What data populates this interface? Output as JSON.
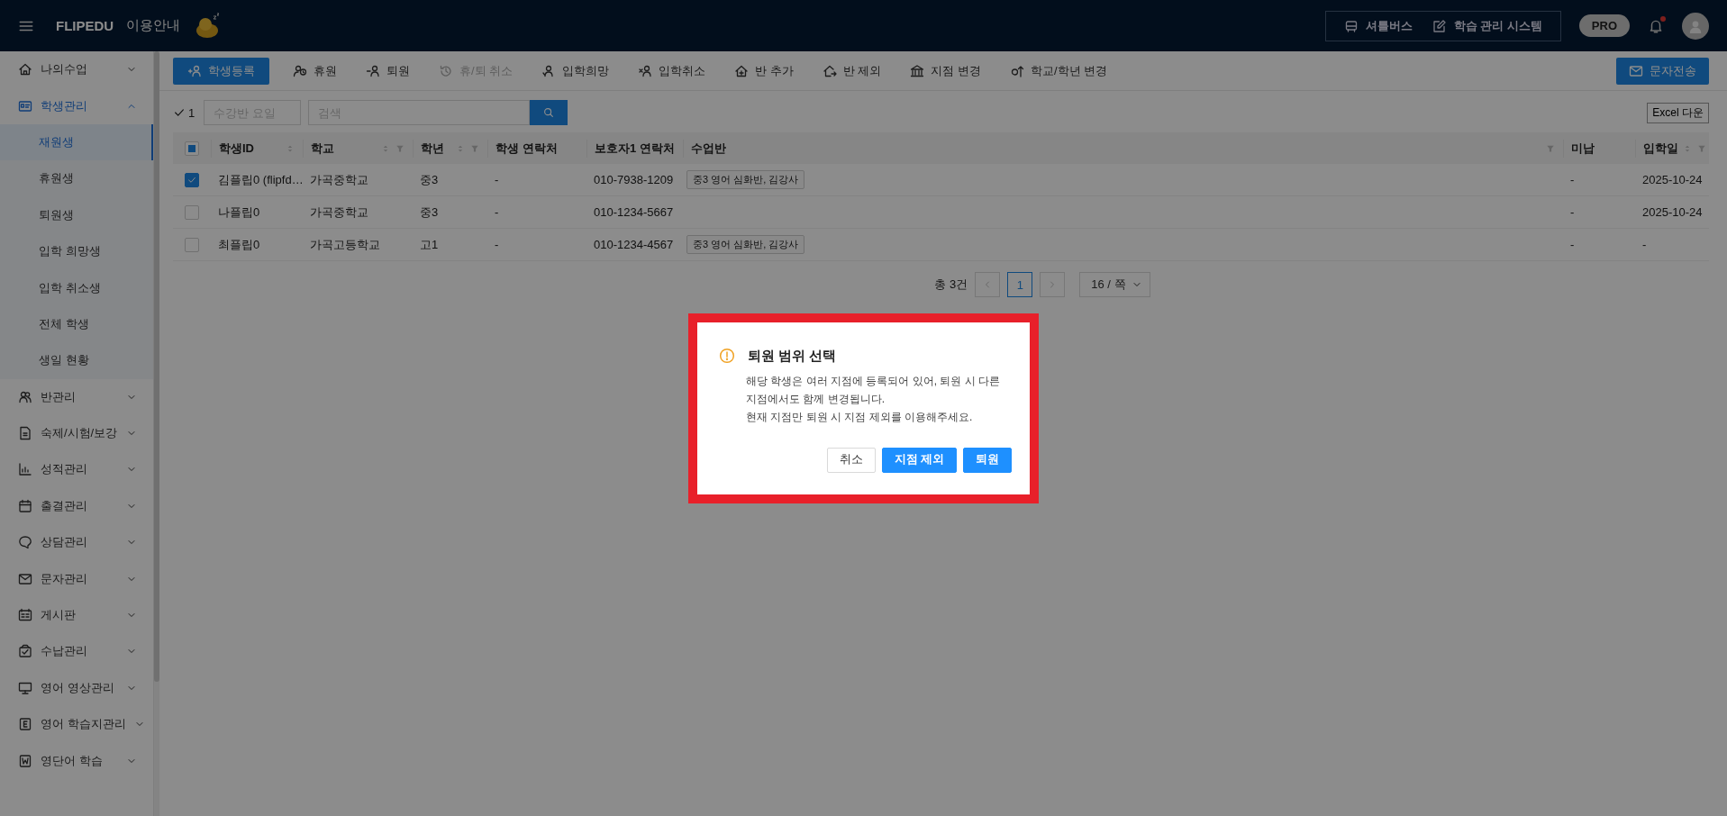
{
  "header": {
    "brand": "FLIPEDU",
    "guide_link": "이용안내",
    "links": [
      {
        "label": "셔틀버스"
      },
      {
        "label": "학습 관리 시스템"
      }
    ],
    "plan_badge": "PRO",
    "has_notification": true
  },
  "sidebar": {
    "items": [
      {
        "label": "나의수업",
        "selected": false,
        "expanded": false
      },
      {
        "label": "학생관리",
        "selected": true,
        "expanded": true,
        "children": [
          {
            "label": "재원생",
            "selected": true
          },
          {
            "label": "휴원생",
            "selected": false
          },
          {
            "label": "퇴원생",
            "selected": false
          },
          {
            "label": "입학 희망생",
            "selected": false
          },
          {
            "label": "입학 취소생",
            "selected": false
          },
          {
            "label": "전체 학생",
            "selected": false
          },
          {
            "label": "생일 현황",
            "selected": false
          }
        ]
      },
      {
        "label": "반관리",
        "selected": false,
        "expanded": false
      },
      {
        "label": "숙제/시험/보강",
        "selected": false,
        "expanded": false
      },
      {
        "label": "성적관리",
        "selected": false,
        "expanded": false
      },
      {
        "label": "출결관리",
        "selected": false,
        "expanded": false
      },
      {
        "label": "상담관리",
        "selected": false,
        "expanded": false
      },
      {
        "label": "문자관리",
        "selected": false,
        "expanded": false
      },
      {
        "label": "게시판",
        "selected": false,
        "expanded": false
      },
      {
        "label": "수납관리",
        "selected": false,
        "expanded": false
      },
      {
        "label": "영어 영상관리",
        "selected": false,
        "expanded": false
      },
      {
        "label": "영어 학습지관리",
        "selected": false,
        "expanded": false
      },
      {
        "label": "영단어 학습",
        "selected": false,
        "expanded": false
      }
    ]
  },
  "toolbar": {
    "actions": [
      {
        "label": "학생등록",
        "kind": "primary",
        "disabled": false
      },
      {
        "label": "휴원",
        "kind": "plain",
        "disabled": false
      },
      {
        "label": "퇴원",
        "kind": "plain",
        "disabled": false
      },
      {
        "label": "휴/퇴 취소",
        "kind": "plain",
        "disabled": true
      },
      {
        "label": "입학희망",
        "kind": "plain",
        "disabled": false
      },
      {
        "label": "입학취소",
        "kind": "plain",
        "disabled": false
      },
      {
        "label": "반 추가",
        "kind": "plain",
        "disabled": false
      },
      {
        "label": "반 제외",
        "kind": "plain",
        "disabled": false
      },
      {
        "label": "지점 변경",
        "kind": "plain",
        "disabled": false
      },
      {
        "label": "학교/학년 변경",
        "kind": "plain",
        "disabled": false
      }
    ],
    "send_button": "문자전송"
  },
  "filters": {
    "selected_count": "1",
    "day_field": {
      "placeholder": "수강반 요일"
    },
    "search_field": {
      "placeholder": "검색"
    },
    "excel_button": "Excel 다운"
  },
  "table": {
    "header_checkbox": {
      "indeterminate": true
    },
    "columns": [
      {
        "label": "학생ID",
        "sortable": true,
        "filterable": false
      },
      {
        "label": "학교",
        "sortable": true,
        "filterable": true
      },
      {
        "label": "학년",
        "sortable": true,
        "filterable": true
      },
      {
        "label": "학생 연락처",
        "sortable": false,
        "filterable": false
      },
      {
        "label": "보호자1 연락처",
        "sortable": false,
        "filterable": false
      },
      {
        "label": "수업반",
        "sortable": false,
        "filterable": true
      },
      {
        "label": "미납",
        "sortable": false,
        "filterable": false
      },
      {
        "label": "입학일",
        "sortable": true,
        "filterable": true
      }
    ],
    "rows": [
      {
        "checked": true,
        "student_id": "김플립0 (flipfd…",
        "school": "가곡중학교",
        "grade": "중3",
        "student_contact": "-",
        "guardian_contact": "010-7938-1209",
        "classes": [
          "중3 영어 심화반, 김강사"
        ],
        "unpaid": "-",
        "enrolled_on": "2025-10-24"
      },
      {
        "checked": false,
        "student_id": "나플립0",
        "school": "가곡중학교",
        "grade": "중3",
        "student_contact": "-",
        "guardian_contact": "010-1234-5667",
        "unpaid": "-",
        "enrolled_on": "2025-10-24"
      },
      {
        "checked": false,
        "student_id": "최플립0",
        "school": "가곡고등학교",
        "grade": "고1",
        "student_contact": "-",
        "guardian_contact": "010-1234-4567",
        "classes": [
          "중3 영어 심화반, 김강사"
        ],
        "unpaid": "-",
        "enrolled_on": "-"
      }
    ]
  },
  "pagination": {
    "total": "총 3건",
    "pages": [
      {
        "label": "1",
        "selected": true
      }
    ],
    "page_size": "16 / 쪽"
  },
  "dialog": {
    "title": "퇴원 범위 선택",
    "lines": [
      "해당 학생은 여러 지점에 등록되어 있어, 퇴원 시 다른",
      "지점에서도 함께 변경됩니다.",
      "현재 지점만 퇴원 시 지점 제외를 이용해주세요."
    ],
    "buttons": [
      {
        "label": "취소",
        "kind": "default"
      },
      {
        "label": "지점 제외",
        "kind": "primary"
      },
      {
        "label": "퇴원",
        "kind": "primary"
      }
    ]
  }
}
